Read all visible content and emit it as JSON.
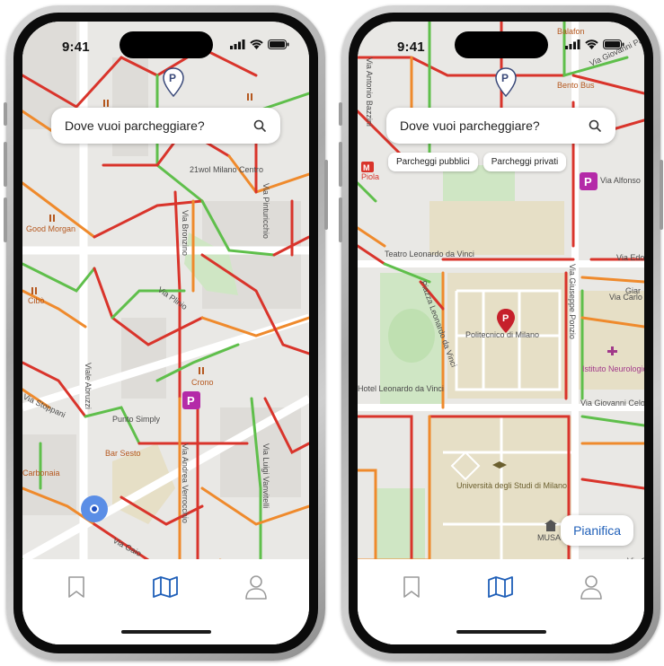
{
  "colors": {
    "accent": "#1f5fb8",
    "parking_purple": "#b42aa8",
    "road_red": "#d9342b",
    "road_orange": "#ef8a2c",
    "road_green": "#5fbf4b"
  },
  "left": {
    "status": {
      "time": "9:41"
    },
    "search": {
      "placeholder": "Dove vuoi parcheggiare?"
    },
    "map_labels": [
      "21wol Milano Centro",
      "Via Pinturicchio",
      "Good Morgan",
      "Via Bronzino",
      "Cibò",
      "Via Plinio",
      "Viale Abruzzi",
      "Crono",
      "Via Andrea Verrocchio",
      "Punto Simply",
      "Via Luigi Vanvitelli",
      "Bar Sesto",
      "Via Stoppani",
      "Carbonaia",
      "Via Gaio"
    ],
    "tabs": {
      "saved_icon": "bookmark-icon",
      "map_icon": "map-icon",
      "profile_icon": "user-icon"
    }
  },
  "right": {
    "status": {
      "time": "9:41"
    },
    "search": {
      "placeholder": "Dove vuoi parcheggiare?"
    },
    "filters": [
      "Parcheggi pubblici",
      "Parcheggi privati"
    ],
    "map_labels": [
      "Balafon",
      "Via Giovanni Pascoli",
      "Bento Bus",
      "Via Antonio Bazzini",
      "Piola",
      "Via Alfonso",
      "Teatro Leonardo da Vinci",
      "Via Edo",
      "Piazza Leonardo da Vinci",
      "Via Giuseppe Ponzio",
      "Politecnico di Milano",
      "Via Carlo Pa",
      "Istituto Neurologico Carlo Besta",
      "Hotel Leonardo da Vinci",
      "Via Giovanni Celo",
      "Università degli Studi di Milano",
      "MUSA",
      "Via Gia",
      "Giar"
    ],
    "action": {
      "pianifica": "Pianifica"
    },
    "tabs": {
      "saved_icon": "bookmark-icon",
      "map_icon": "map-icon",
      "profile_icon": "user-icon"
    }
  }
}
